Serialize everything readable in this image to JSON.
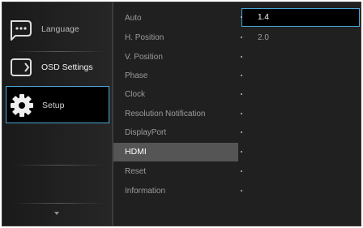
{
  "sidebar": {
    "items": [
      {
        "label": "Language",
        "icon": "speech-bubble-icon"
      },
      {
        "label": "OSD Settings",
        "icon": "osd-settings-icon"
      },
      {
        "label": "Setup",
        "icon": "gear-icon"
      }
    ],
    "selected": "Setup",
    "scroll_icon": "chevron-down-icon"
  },
  "menu": {
    "items": [
      "Auto",
      "H. Position",
      "V. Position",
      "Phase",
      "Clock",
      "Resolution Notification",
      "DisplayPort",
      "HDMI",
      "Reset",
      "Information"
    ],
    "selected": "HDMI"
  },
  "values": {
    "options": [
      "1.4",
      "2.0"
    ],
    "selected": "1.4"
  },
  "colors": {
    "accent": "#49a6d8",
    "background": "#202020",
    "highlight_row": "#555555"
  }
}
